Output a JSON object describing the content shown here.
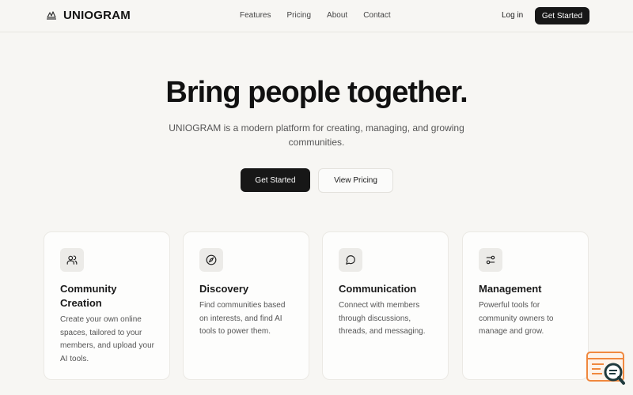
{
  "header": {
    "brand": "UNIOGRAM",
    "nav": [
      "Features",
      "Pricing",
      "About",
      "Contact"
    ],
    "login_label": "Log in",
    "cta_label": "Get Started"
  },
  "hero": {
    "title": "Bring people together.",
    "subtitle": "UNIOGRAM is a modern platform for creating, managing, and growing communities.",
    "primary_label": "Get Started",
    "secondary_label": "View Pricing"
  },
  "features": [
    {
      "icon": "users-icon",
      "title": "Community Creation",
      "description": "Create your own online spaces, tailored to your members, and upload your AI tools."
    },
    {
      "icon": "compass-icon",
      "title": "Discovery",
      "description": "Find communities based on interests, and find AI tools to power them."
    },
    {
      "icon": "message-circle-icon",
      "title": "Communication",
      "description": "Connect with members through discussions, threads, and messaging."
    },
    {
      "icon": "sliders-icon",
      "title": "Management",
      "description": "Powerful tools for community owners to manage and grow."
    }
  ],
  "colors": {
    "background": "#f7f6f3",
    "primary": "#171717",
    "card_bg": "#fdfdfc",
    "icon_bg": "#ecebe8",
    "widget_accent": "#f0883e",
    "widget_dark": "#1f3a3d"
  }
}
